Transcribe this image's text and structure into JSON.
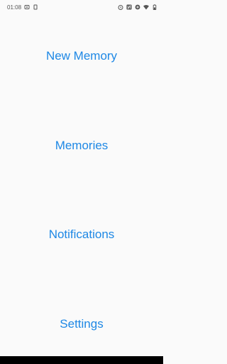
{
  "status_bar": {
    "time": "01:08"
  },
  "menu": {
    "items": [
      {
        "label": "New Memory"
      },
      {
        "label": "Memories"
      },
      {
        "label": "Notifications"
      },
      {
        "label": "Settings"
      }
    ]
  },
  "colors": {
    "accent": "#1e88e5",
    "background": "#fafafa"
  }
}
